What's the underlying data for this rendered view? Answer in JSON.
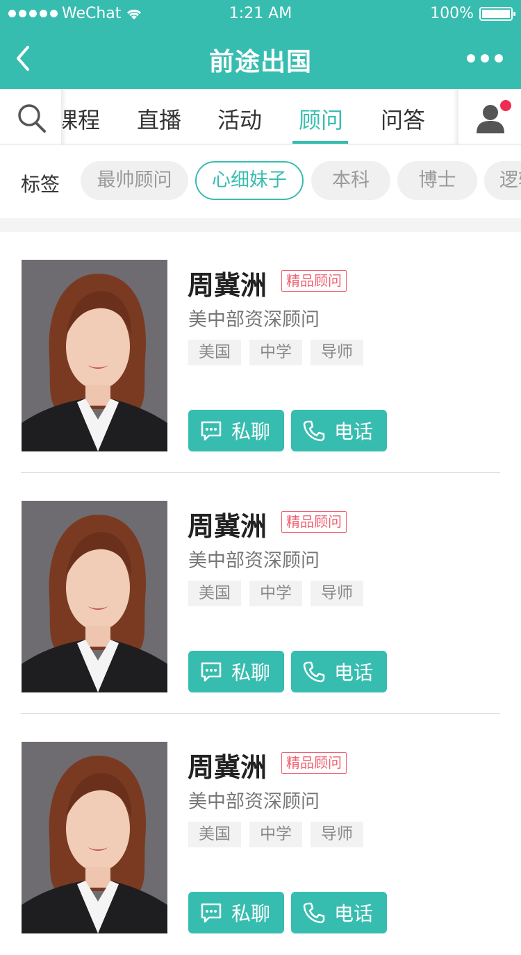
{
  "status_bar": {
    "carrier": "WeChat",
    "time": "1:21 AM",
    "battery": "100%"
  },
  "nav": {
    "title": "前途出国"
  },
  "tabs": {
    "items": [
      {
        "label": "课程",
        "active": false
      },
      {
        "label": "直播",
        "active": false
      },
      {
        "label": "活动",
        "active": false
      },
      {
        "label": "顾问",
        "active": true
      },
      {
        "label": "问答",
        "active": false
      }
    ]
  },
  "tags": {
    "label": "标签",
    "items": [
      {
        "label": "最帅顾问",
        "active": false
      },
      {
        "label": "心细妹子",
        "active": true
      },
      {
        "label": "本科",
        "active": false
      },
      {
        "label": "博士",
        "active": false
      },
      {
        "label": "逻辑",
        "active": false
      }
    ]
  },
  "advisors": [
    {
      "name": "周冀洲",
      "badge": "精品顾问",
      "role": "美中部资深顾问",
      "tags": [
        "美国",
        "中学",
        "导师"
      ],
      "chat_label": "私聊",
      "call_label": "电话"
    },
    {
      "name": "周冀洲",
      "badge": "精品顾问",
      "role": "美中部资深顾问",
      "tags": [
        "美国",
        "中学",
        "导师"
      ],
      "chat_label": "私聊",
      "call_label": "电话"
    },
    {
      "name": "周冀洲",
      "badge": "精品顾问",
      "role": "美中部资深顾问",
      "tags": [
        "美国",
        "中学",
        "导师"
      ],
      "chat_label": "私聊",
      "call_label": "电话"
    }
  ],
  "colors": {
    "brand": "#37bdb0",
    "badge": "#f06070",
    "notification": "#ef2b52"
  }
}
